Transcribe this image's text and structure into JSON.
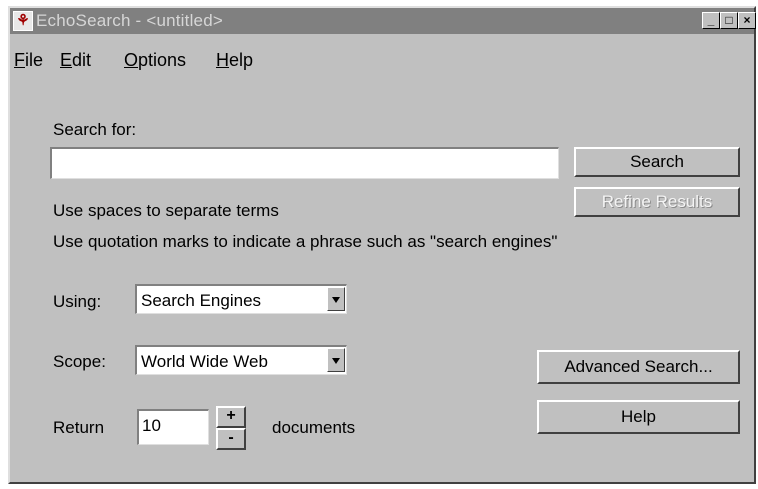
{
  "window": {
    "title": "EchoSearch - <untitled>",
    "minimize_glyph": "_",
    "maximize_glyph": "□",
    "close_glyph": "×",
    "app_icon_glyph": "⚘"
  },
  "menu": {
    "file": "File",
    "edit": "Edit",
    "options": "Options",
    "help": "Help"
  },
  "search": {
    "label": "Search for:",
    "value": "",
    "search_button": "Search",
    "refine_button": "Refine Results",
    "hint1": "Use spaces to separate terms",
    "hint2": "Use quotation marks to indicate a phrase such as \"search engines\""
  },
  "using": {
    "label": "Using:",
    "selected": "Search Engines"
  },
  "scope": {
    "label": "Scope:",
    "selected": "World Wide Web"
  },
  "return": {
    "label": "Return",
    "value": "10",
    "increment": "+",
    "decrement": "-",
    "suffix": "documents"
  },
  "buttons": {
    "advanced": "Advanced Search...",
    "help": "Help"
  }
}
